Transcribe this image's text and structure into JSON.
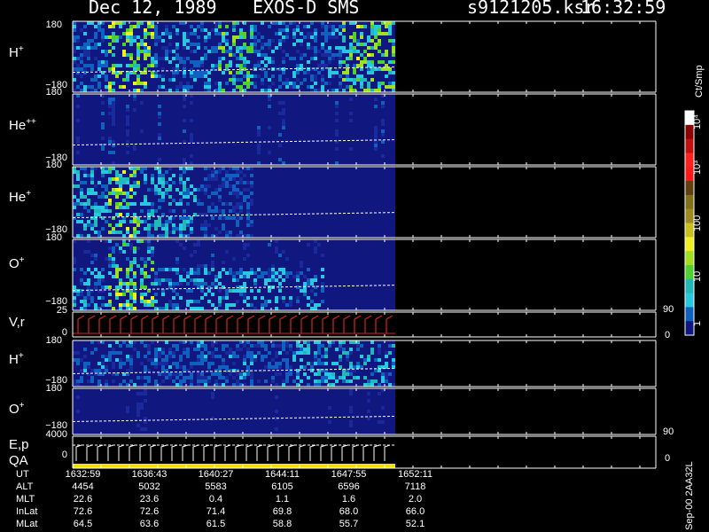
{
  "header": {
    "date": "Dec 12, 1989",
    "instrument": "EXOS-D SMS",
    "file": "s9121205.ksr",
    "time": "16:32:59"
  },
  "chart_data": [
    {
      "type": "heatmap",
      "panel": "H+",
      "label_base": "H",
      "label_sup": "+",
      "ylim": [
        -180,
        180
      ],
      "yticks_shown": [
        "180",
        "−180"
      ],
      "colors": [
        "#1c1c8c",
        "#2aa8d8",
        "#3cd23c",
        "#f0e010"
      ],
      "end_fraction": 1.0
    },
    {
      "type": "heatmap",
      "panel": "He++",
      "label_base": "He",
      "label_sup": "++",
      "ylim": [
        -180,
        180
      ],
      "yticks_shown": [
        "180",
        "−180"
      ]
    },
    {
      "type": "heatmap",
      "panel": "He+",
      "label_base": "He",
      "label_sup": "+",
      "ylim": [
        -180,
        180
      ],
      "yticks_shown": [
        "180",
        "−180"
      ]
    },
    {
      "type": "heatmap",
      "panel": "O+",
      "label_base": "O",
      "label_sup": "+",
      "ylim": [
        -180,
        180
      ],
      "yticks_shown": [
        "180",
        "−180"
      ]
    },
    {
      "type": "line",
      "panel": "V,r",
      "label": "V,r",
      "ylim_left": [
        0,
        25
      ],
      "left_ticks": [
        "25",
        "0"
      ],
      "right_ticks": [
        "90",
        "0"
      ],
      "color": "#e02020"
    },
    {
      "type": "heatmap",
      "panel": "H+ (lower)",
      "label_base": "H",
      "label_sup": "+",
      "ylim": [
        -180,
        180
      ],
      "yticks_shown": [
        "180",
        "−180"
      ]
    },
    {
      "type": "heatmap",
      "panel": "O+ (lower)",
      "label_base": "O",
      "label_sup": "+",
      "ylim": [
        -180,
        180
      ],
      "yticks_shown": [
        "180",
        "−180"
      ]
    },
    {
      "type": "line",
      "panel": "E,p QA",
      "label_top": "E,p",
      "label_bottom": "QA",
      "left_ticks": [
        "4000",
        "0"
      ],
      "right_ticks": [
        "90",
        "0"
      ]
    }
  ],
  "colorbar": {
    "unit": "Ct/Smp",
    "labels": [
      "10⁴",
      "10³",
      "100",
      "10",
      "1"
    ],
    "colors": [
      "#ffffff",
      "#8b0000",
      "#c01010",
      "#ff2020",
      "#ff1a1a",
      "#604010",
      "#80701a",
      "#a08a20",
      "#c8c020",
      "#f0f020",
      "#a0e020",
      "#50d030",
      "#20b8b8",
      "#28c8e0",
      "#1060c0",
      "#101880"
    ]
  },
  "ephemeris": {
    "rows": [
      {
        "label": "UT",
        "values": [
          "1632:59",
          "1636:43",
          "1640:27",
          "1644:11",
          "1647:55",
          "1652:11"
        ]
      },
      {
        "label": "ALT",
        "values": [
          "4454",
          "5032",
          "5583",
          "6105",
          "6596",
          "7118"
        ]
      },
      {
        "label": "MLT",
        "values": [
          "22.6",
          "23.6",
          "0.4",
          "1.1",
          "1.6",
          "2.0"
        ]
      },
      {
        "label": "InLat",
        "values": [
          "72.6",
          "72.6",
          "71.4",
          "69.8",
          "68.0",
          "66.0"
        ]
      },
      {
        "label": "MLat",
        "values": [
          "64.5",
          "63.6",
          "61.5",
          "58.8",
          "55.7",
          "52.1"
        ]
      }
    ]
  },
  "footer": "Sep-00  2AA32L"
}
